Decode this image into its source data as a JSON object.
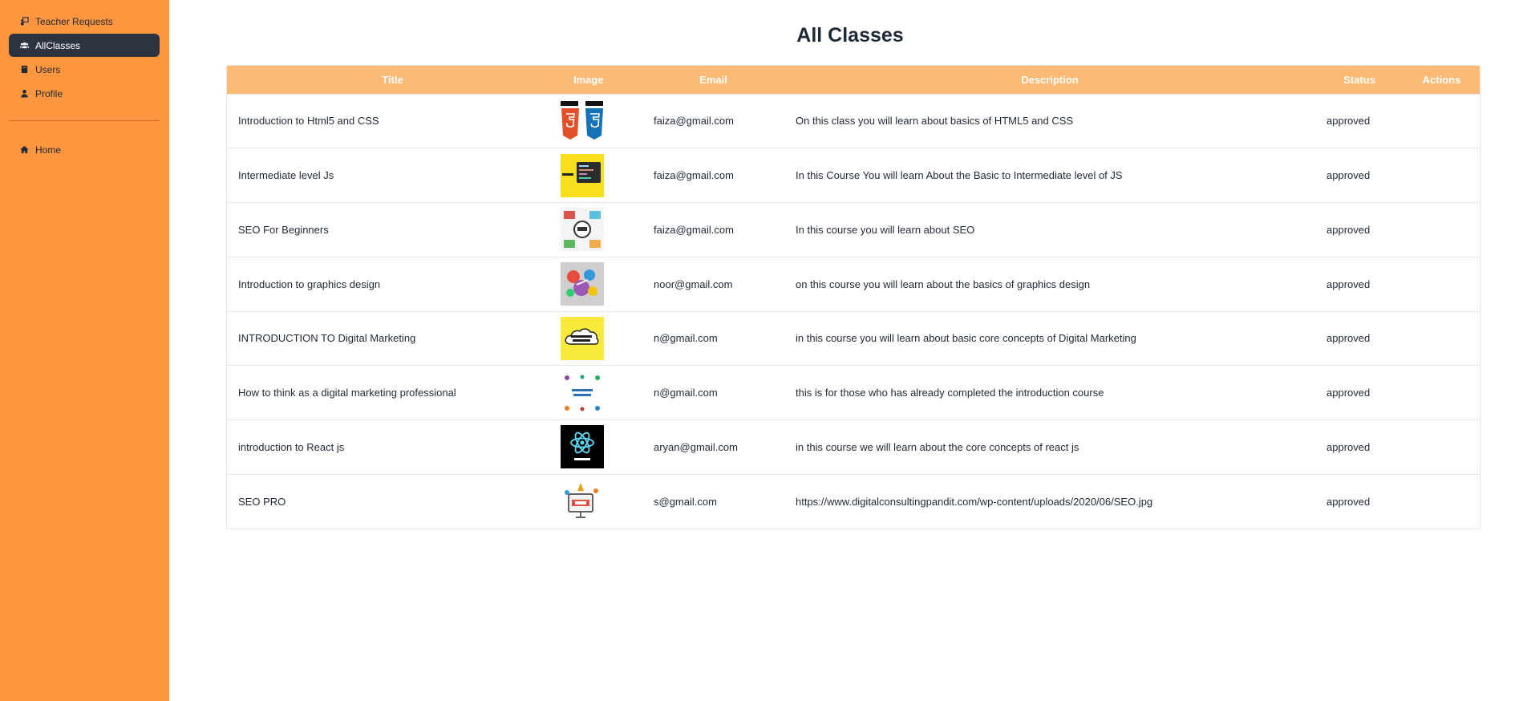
{
  "sidebar": {
    "items": [
      {
        "label": "Teacher Requests",
        "icon": "chalkboard-teacher-icon"
      },
      {
        "label": "AllClasses",
        "icon": "users-icon",
        "active": true
      },
      {
        "label": "Users",
        "icon": "book-icon"
      },
      {
        "label": "Profile",
        "icon": "user-icon"
      }
    ],
    "home": {
      "label": "Home",
      "icon": "home-icon"
    }
  },
  "main": {
    "title": "All Classes",
    "table": {
      "headers": [
        "Title",
        "Image",
        "Email",
        "Description",
        "Status",
        "Actions"
      ],
      "rows": [
        {
          "title": "Introduction to Html5 and CSS",
          "image": "html5-css3-logo-thumbnail",
          "email": "faiza@gmail.com",
          "description": "On this class you will learn about basics of HTML5 and CSS",
          "status": "approved"
        },
        {
          "title": "Intermediate level Js",
          "image": "javascript-code-thumbnail",
          "email": "faiza@gmail.com",
          "description": "In this Course You will learn About the Basic to Intermediate level of JS",
          "status": "approved"
        },
        {
          "title": "SEO For Beginners",
          "image": "seo-graphic-thumbnail",
          "email": "faiza@gmail.com",
          "description": "In this course you will learn about SEO",
          "status": "approved"
        },
        {
          "title": "Introduction to graphics design",
          "image": "graphics-design-thumbnail",
          "email": "noor@gmail.com",
          "description": "on this course you will learn about the basics of graphics design",
          "status": "approved"
        },
        {
          "title": "INTRODUCTION TO Digital Marketing",
          "image": "digital-marketing-cloud-thumbnail",
          "email": "n@gmail.com",
          "description": "in this course you will learn about basic core concepts of Digital Marketing",
          "status": "approved"
        },
        {
          "title": "How to think as a digital marketing professional",
          "image": "digital-marketing-icons-thumbnail",
          "email": "n@gmail.com",
          "description": "this is for those who has already completed the introduction course",
          "status": "approved"
        },
        {
          "title": "introduction to React js",
          "image": "react-js-logo-thumbnail",
          "email": "aryan@gmail.com",
          "description": "in this course we will learn about the core concepts of react js",
          "status": "approved"
        },
        {
          "title": "SEO PRO",
          "image": "seo-pro-thumbnail",
          "email": "s@gmail.com",
          "description": "https://www.digitalconsultingpandit.com/wp-content/uploads/2020/06/SEO.jpg",
          "status": "approved"
        }
      ]
    }
  },
  "colors": {
    "sidebar_bg": "#fd963e",
    "active_item_bg": "#2d3440",
    "table_header_bg": "#fdba74",
    "header_text": "#ffffff",
    "body_text": "#1f2937"
  }
}
